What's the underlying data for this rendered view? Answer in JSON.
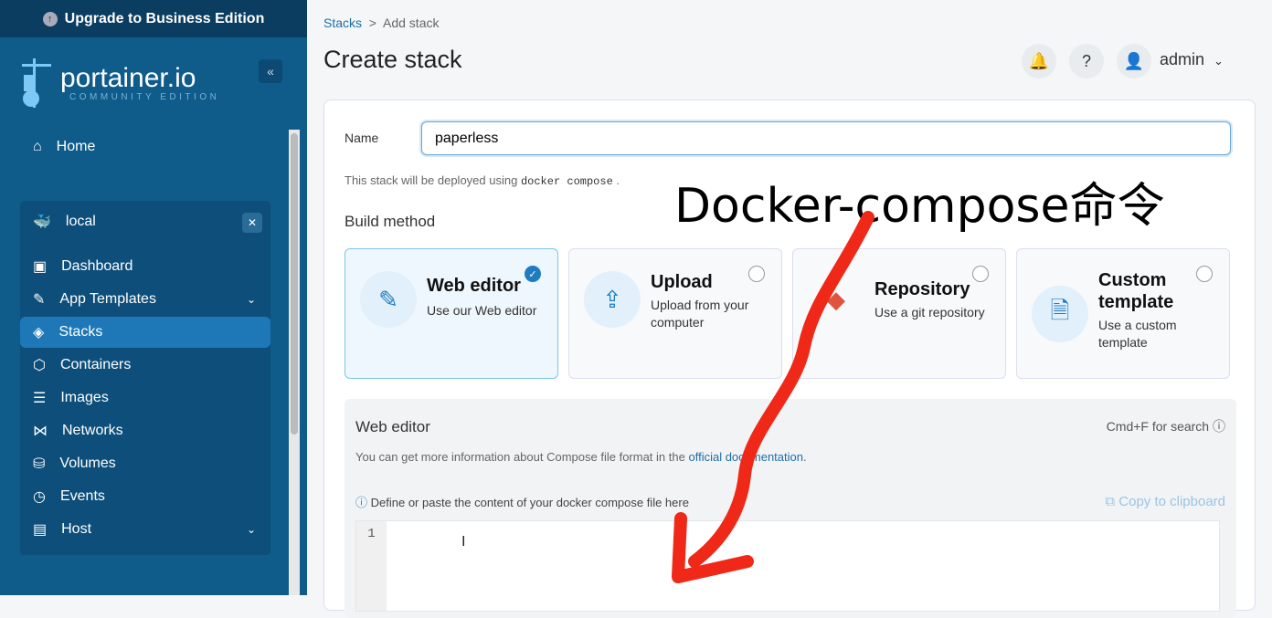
{
  "sidebar": {
    "upgrade": "Upgrade to Business Edition",
    "logo": {
      "word": "portainer.io",
      "sub": "COMMUNITY EDITION"
    },
    "collapse": "«",
    "home": "Home",
    "environment": "local",
    "items": [
      {
        "label": "Dashboard",
        "icon": "dashboard-icon"
      },
      {
        "label": "App Templates",
        "icon": "edit-icon",
        "chevron": true
      },
      {
        "label": "Stacks",
        "icon": "layers-icon",
        "active": true
      },
      {
        "label": "Containers",
        "icon": "box-icon"
      },
      {
        "label": "Images",
        "icon": "list-icon"
      },
      {
        "label": "Networks",
        "icon": "share-icon"
      },
      {
        "label": "Volumes",
        "icon": "database-icon"
      },
      {
        "label": "Events",
        "icon": "clock-icon"
      },
      {
        "label": "Host",
        "icon": "server-icon",
        "chevron": true
      }
    ]
  },
  "header": {
    "breadcrumb": [
      "Stacks",
      "Add stack"
    ],
    "separator": ">",
    "title": "Create stack",
    "user": "admin"
  },
  "form": {
    "name_label": "Name",
    "name_value": "paperless",
    "hint_prefix": "This stack will be deployed using",
    "hint_code": "docker compose",
    "hint_suffix": ".",
    "build_method": "Build method",
    "methods": [
      {
        "title": "Web editor",
        "desc": "Use our Web editor",
        "selected": true
      },
      {
        "title": "Upload",
        "desc": "Upload from your computer"
      },
      {
        "title": "Repository",
        "desc": "Use a git repository"
      },
      {
        "title": "Custom template",
        "desc": "Use a custom template"
      }
    ],
    "editor": {
      "title": "Web editor",
      "search_hint": "Cmd+F for search",
      "info_prefix": "You can get more information about Compose file format in the",
      "info_link": "official documentation",
      "info_suffix": ".",
      "define": "Define or paste the content of your docker compose file here",
      "copy": "Copy to clipboard",
      "line": "1"
    }
  },
  "annotation": {
    "text": "Docker-compose命令",
    "color": "#f02818"
  },
  "colors": {
    "sidebar": "#0f5c8a",
    "active": "#1e78b8",
    "accent": "#1f7cc0"
  }
}
